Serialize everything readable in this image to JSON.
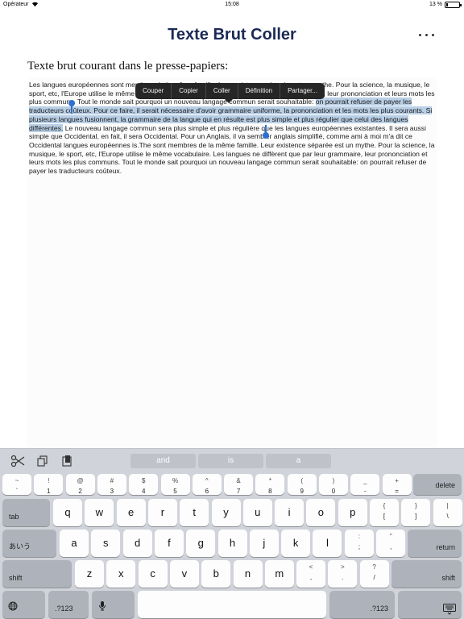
{
  "status_bar": {
    "carrier": "Opérateur",
    "time": "15:08",
    "battery_text": "13 %",
    "battery_level": 0.13
  },
  "nav": {
    "title": "Texte Brut Coller",
    "more_icon": "ellipsis-icon"
  },
  "subtitle": "Texte brut courant dans le presse-papiers:",
  "text": {
    "before": "Les langues européennes sont membres de la même famille. Leur existence séparée est un mythe. Pour la science, la musique, le sport, etc, l'Europe utilise le même vocabulaire. Les langues ne diffèrent que par leur grammaire, leur prononciation et leurs mots les plus communs. Tout le monde sait pourquoi un nouveau langage commun serait souhaitable: ",
    "selected": "on pourrait refuser de payer les traducteurs coûteux. Pour ce faire, il serait nécessaire d'avoir grammaire uniforme, la prononciation et les mots les plus courants. Si plusieurs langues fusionnent, la grammaire de la langue qui en résulte est plus simple et plus régulier que celui des langues différentes.",
    "after": " Le nouveau langage commun sera plus simple et plus régulière que les langues européennes existantes. Il sera aussi simple que Occidental, en fait, il sera Occidental. Pour un Anglais, il va sembler anglais simplifié, comme ami à moi m'a dit ce Occidental langues européennes is.The sont membres de la même famille. Leur existence séparée est un mythe. Pour la science, la musique, le sport, etc, l'Europe utilise le même vocabulaire. Les langues ne diffèrent que par leur grammaire, leur prononciation et leurs mots les plus communs. Tout le monde sait pourquoi un nouveau langage commun serait souhaitable: on pourrait refuser de payer les traducteurs coûteux."
  },
  "edit_menu": [
    "Couper",
    "Copier",
    "Coller",
    "Définition",
    "Partager..."
  ],
  "keyboard": {
    "predictions": [
      "and",
      "is",
      "a"
    ],
    "row1": [
      [
        "~",
        "`"
      ],
      [
        "!",
        "1"
      ],
      [
        "@",
        "2"
      ],
      [
        "#",
        "3"
      ],
      [
        "$",
        "4"
      ],
      [
        "%",
        "5"
      ],
      [
        "^",
        "6"
      ],
      [
        "&",
        "7"
      ],
      [
        "*",
        "8"
      ],
      [
        "(",
        "9"
      ],
      [
        ")",
        "0"
      ],
      [
        "_",
        "-"
      ],
      [
        "+",
        "="
      ]
    ],
    "delete": "delete",
    "tab": "tab",
    "row2": [
      "q",
      "w",
      "e",
      "r",
      "t",
      "y",
      "u",
      "i",
      "o",
      "p"
    ],
    "row2_sym": [
      [
        "{",
        "["
      ],
      [
        "}",
        "]"
      ],
      [
        "|",
        "\\"
      ]
    ],
    "lang": "あいう",
    "row3": [
      "a",
      "s",
      "d",
      "f",
      "g",
      "h",
      "j",
      "k",
      "l"
    ],
    "row3_sym": [
      [
        ":",
        ";"
      ],
      [
        "\"",
        ","
      ]
    ],
    "return": "return",
    "shift": "shift",
    "row4": [
      "z",
      "x",
      "c",
      "v",
      "b",
      "n",
      "m"
    ],
    "row4_sym": [
      [
        "<",
        ","
      ],
      [
        ">",
        "."
      ],
      [
        "?",
        "/"
      ]
    ],
    "numbers": ".?123"
  }
}
